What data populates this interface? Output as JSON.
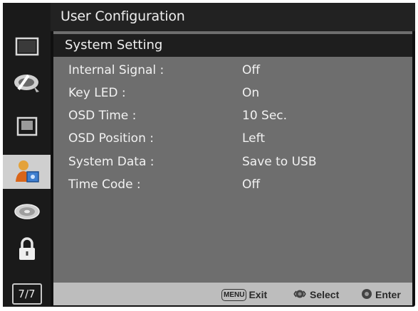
{
  "header": {
    "title": "User Configuration"
  },
  "sidebar": {
    "items": [
      {
        "icon": "monitor-icon",
        "active": false
      },
      {
        "icon": "color-palette-icon",
        "active": false
      },
      {
        "icon": "screen-frame-icon",
        "active": false
      },
      {
        "icon": "user-config-icon",
        "active": true
      },
      {
        "icon": "disc-icon",
        "active": false
      },
      {
        "icon": "lock-icon",
        "active": false
      }
    ],
    "page_indicator": "7/7"
  },
  "section": {
    "title": "System Setting"
  },
  "settings": [
    {
      "label": "Internal Signal :",
      "value": "Off"
    },
    {
      "label": "Key LED :",
      "value": "On"
    },
    {
      "label": "OSD Time :",
      "value": "10 Sec."
    },
    {
      "label": "OSD Position :",
      "value": "Left"
    },
    {
      "label": "System Data :",
      "value": "Save to USB"
    },
    {
      "label": "Time Code :",
      "value": "Off"
    }
  ],
  "footer": {
    "menu_key": "MENU",
    "exit_label": "Exit",
    "select_label": "Select",
    "enter_label": "Enter"
  },
  "colors": {
    "content_bg": "#6e6e6e",
    "header_bg": "#222222",
    "footer_bg": "#bdbdbd",
    "active_tab_bg": "#cfcfcf"
  }
}
